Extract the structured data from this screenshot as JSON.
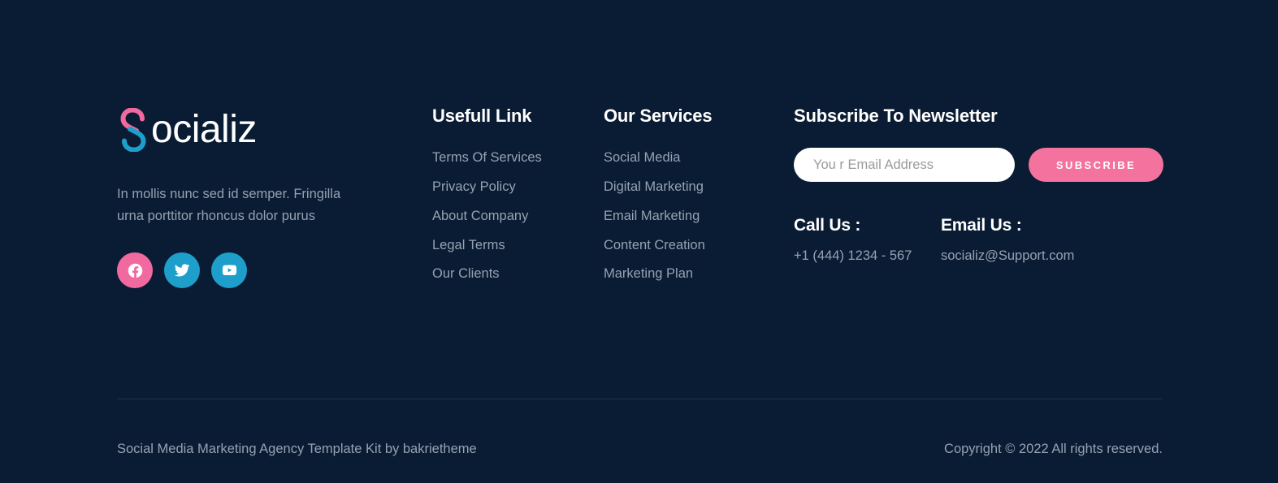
{
  "colors": {
    "background": "#0a1c33",
    "accent_pink": "#f4729e",
    "accent_blue": "#1d9ecb",
    "heading": "#ffffff",
    "muted_text": "#96a2b2",
    "divider": "#1e3352"
  },
  "brand": {
    "logo_initial": "S",
    "logo_word": "ocializ",
    "description": "In mollis nunc sed id semper. Fringilla urna porttitor rhoncus dolor purus",
    "socials": [
      {
        "name": "facebook-icon",
        "label": "Facebook",
        "color": "#f0699f"
      },
      {
        "name": "twitter-icon",
        "label": "Twitter",
        "color": "#1d9ecb"
      },
      {
        "name": "youtube-icon",
        "label": "YouTube",
        "color": "#1d9ecb"
      }
    ]
  },
  "useful_link": {
    "heading": "Usefull Link",
    "items": [
      {
        "label": "Terms Of Services"
      },
      {
        "label": "Privacy Policy"
      },
      {
        "label": "About Company"
      },
      {
        "label": "Legal Terms"
      },
      {
        "label": "Our Clients"
      }
    ]
  },
  "our_services": {
    "heading": "Our Services",
    "items": [
      {
        "label": "Social Media"
      },
      {
        "label": "Digital Marketing"
      },
      {
        "label": "Email Marketing"
      },
      {
        "label": "Content Creation"
      },
      {
        "label": "Marketing Plan"
      }
    ]
  },
  "newsletter": {
    "heading": "Subscribe To Newsletter",
    "email_placeholder": "You r Email Address",
    "email_value": "",
    "subscribe_label": "SUBSCRIBE"
  },
  "contact": {
    "call": {
      "title": "Call Us :",
      "value": "+1 (444) 1234 - 567"
    },
    "email": {
      "title": "Email Us :",
      "value": "socializ@Support.com"
    }
  },
  "bottom_bar": {
    "credit": "Social Media Marketing Agency Template Kit by bakrietheme",
    "copyright": "Copyright © 2022 All rights reserved."
  }
}
